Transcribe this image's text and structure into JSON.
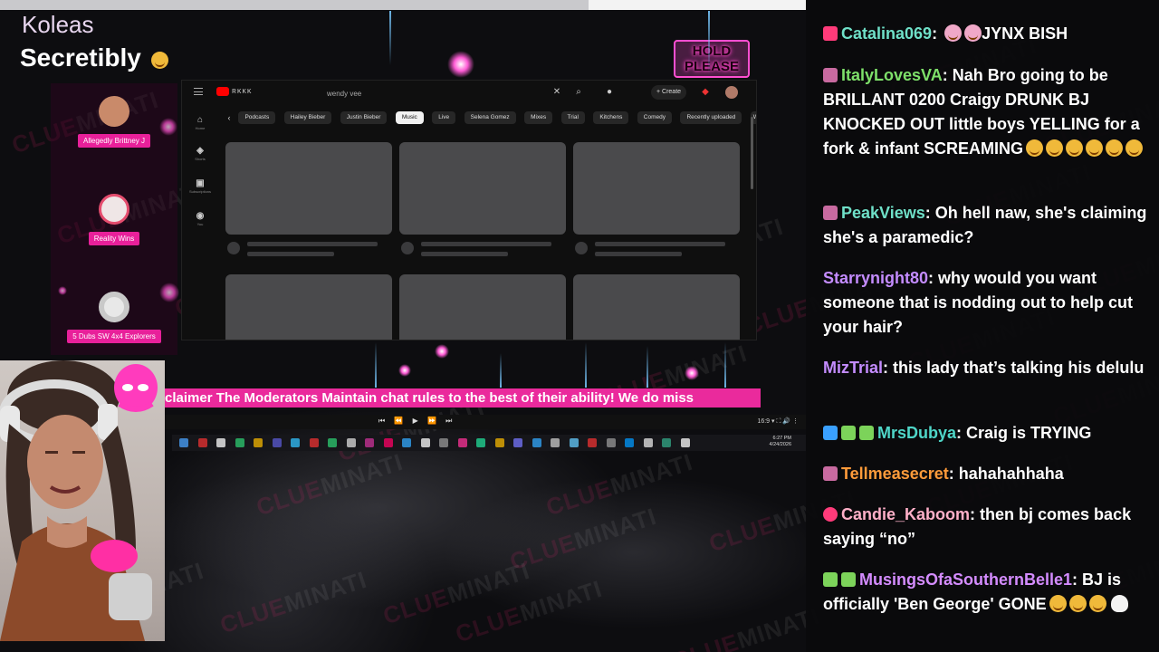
{
  "overlay": {
    "streamer_name": "Koleas",
    "game_title": "Secretibly",
    "hold_line1": "HOLD",
    "hold_line2": "PLEASE",
    "watermark_a": "CLUE",
    "watermark_b": "MINATI",
    "accent_pink": "#ea2a9c"
  },
  "members": [
    {
      "label": "Allegedly Brittney J",
      "avatar_color": "#c98a6a"
    },
    {
      "label": "Reality Wins",
      "avatar_color": "#e44d6e"
    },
    {
      "label": "5 Dubs SW 4x4 Explorers",
      "avatar_color": "#d8d8d8"
    }
  ],
  "youtube": {
    "logo_text": "ʀᴋᴋᴋ",
    "search_value": "wendy vee",
    "create_label": "+ Create",
    "sidebar": [
      {
        "label": "Home",
        "icon": "home-icon",
        "glyph": "⌂"
      },
      {
        "label": "Shorts",
        "icon": "shorts-icon",
        "glyph": "◈"
      },
      {
        "label": "Subscriptions",
        "icon": "subscriptions-icon",
        "glyph": "▣"
      },
      {
        "label": "You",
        "icon": "user-icon",
        "glyph": "◉"
      }
    ],
    "chips": [
      "Podcasts",
      "Hailey Bieber",
      "Justin Bieber",
      "Music",
      "Live",
      "Selena Gomez",
      "Mixes",
      "Trial",
      "Kitchens",
      "Comedy",
      "Recently uploaded",
      "W"
    ],
    "active_chip": "Music"
  },
  "ticker": {
    "text": "claimer The Moderators Maintain chat rules to the best of their ability! We do miss"
  },
  "media": {
    "controls": "⏮ ⏪ ▶ ⏩ ⏭",
    "right": "16:9 ▾   ⛶   🔊  ⋮"
  },
  "taskbar": {
    "time": "6:27 PM",
    "date": "4/24/2026"
  },
  "chat": {
    "messages": [
      {
        "user": "Catalina069",
        "user_color": "#6fe0c8",
        "badges": [
          "tiktok-badge"
        ],
        "text": "JYNX BISH",
        "emotes_before": 2,
        "emotes_after": 0
      },
      {
        "user": "ItalyLovesVA",
        "user_color": "#7ee06a",
        "badges": [
          "sub-badge"
        ],
        "text": "Nah Bro going to be BRILLANT 0200 Craigy DRUNK BJ KNOCKED OUT little boys YELLING for a fork & infant SCREAMING",
        "emotes_before": 0,
        "emotes_after": 6
      },
      {
        "user": "PeakViews",
        "user_color": "#6fe0c8",
        "badges": [
          "sub-badge"
        ],
        "text": "Oh hell naw, she's claiming she's a paramedic?",
        "emotes_before": 0,
        "emotes_after": 0
      },
      {
        "user": "Starrynight80",
        "user_color": "#c48cff",
        "badges": [],
        "text": "why would you want someone that is nodding out to help cut your hair?",
        "emotes_before": 0,
        "emotes_after": 0
      },
      {
        "user": "MizTrial",
        "user_color": "#c48cff",
        "badges": [],
        "text": "this lady that’s talking his delulu",
        "emotes_before": 0,
        "emotes_after": 0
      },
      {
        "user": "MrsDubya",
        "user_color": "#4fd6c8",
        "badges": [
          "vip-badge",
          "dino-badge",
          "gift-badge"
        ],
        "text": "Craig is TRYING",
        "emotes_before": 0,
        "emotes_after": 0
      },
      {
        "user": "Tellmeasecret",
        "user_color": "#ff9b3a",
        "badges": [
          "sub-badge"
        ],
        "text": "hahahahhaha",
        "emotes_before": 0,
        "emotes_after": 0
      },
      {
        "user": "Candie_Kaboom",
        "user_color": "#ffb0c8",
        "badges": [
          "heart-badge"
        ],
        "text": "then bj comes back saying “no”",
        "emotes_before": 0,
        "emotes_after": 0
      },
      {
        "user": "MusingsOfaSouthernBelle1",
        "user_color": "#d48cff",
        "badges": [
          "dino-badge",
          "gift-badge"
        ],
        "text": "BJ is officially 'Ben George' GONE",
        "emotes_before": 0,
        "emotes_after": 3
      }
    ]
  }
}
